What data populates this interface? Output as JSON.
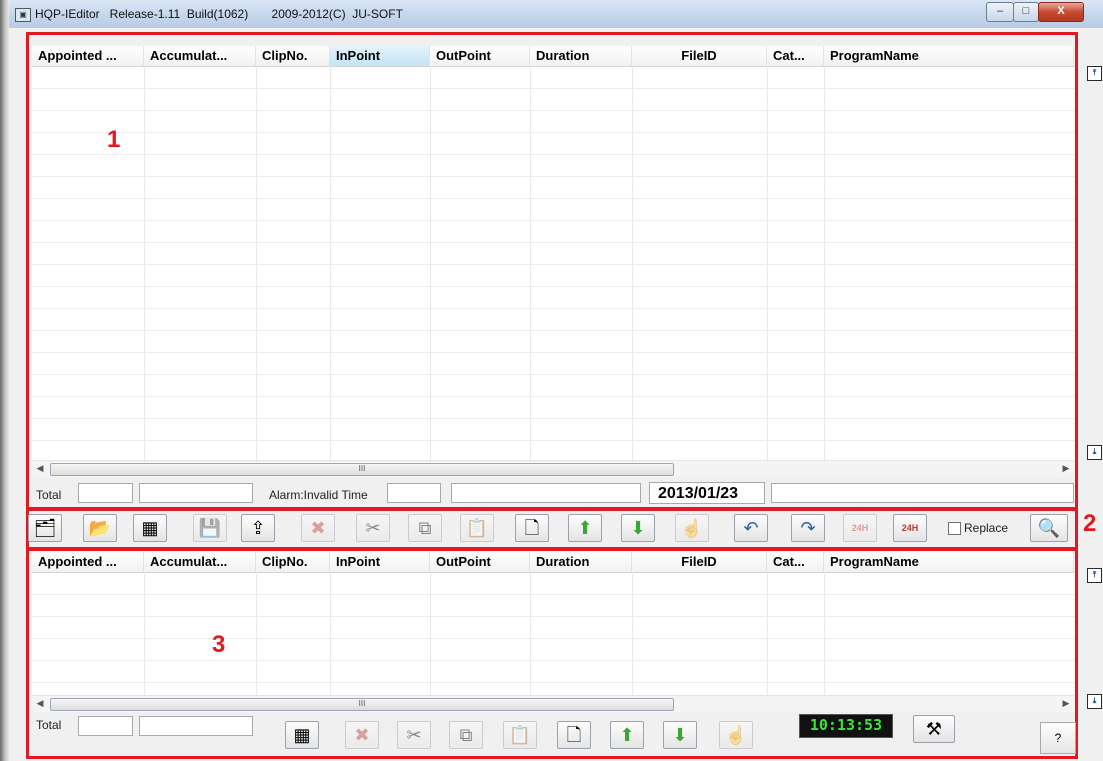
{
  "window": {
    "title": "HQP-IEditor   Release-1.11  Build(1062)       2009-2012(C)  JU-SOFT",
    "min_glyph": "–",
    "max_glyph": "□",
    "close_glyph": "X"
  },
  "panel_labels": {
    "top": "1",
    "toolbar": "2",
    "bottom": "3"
  },
  "columns": [
    "Appointed ...",
    "Accumulat...",
    "ClipNo.",
    "InPoint",
    "OutPoint",
    "Duration",
    "FileID",
    "Cat...",
    "ProgramName"
  ],
  "top_grid": {
    "selected_column": "InPoint",
    "scroll_thumb_glyph": "III"
  },
  "top_status": {
    "total_label": "Total",
    "alarm_label": "Alarm:Invalid Time",
    "date": "2013/01/23"
  },
  "toolbar": {
    "buttons": [
      {
        "name": "open-list",
        "icon": "folder-list-icon",
        "glyph": "🗂"
      },
      {
        "name": "import",
        "icon": "folder-import-icon",
        "glyph": "📂"
      },
      {
        "name": "calculator",
        "icon": "calculator-icon",
        "glyph": "▦"
      },
      {
        "name": "save",
        "icon": "save-icon",
        "glyph": "💾"
      },
      {
        "name": "upload-timeline",
        "icon": "upload-timeline-icon",
        "glyph": "⇪"
      },
      {
        "name": "delete",
        "icon": "delete-icon",
        "glyph": "✖"
      },
      {
        "name": "cut",
        "icon": "scissors-icon",
        "glyph": "✂"
      },
      {
        "name": "copy",
        "icon": "copy-icon",
        "glyph": "⧉"
      },
      {
        "name": "paste",
        "icon": "paste-icon",
        "glyph": "📋"
      },
      {
        "name": "new",
        "icon": "new-document-icon",
        "glyph": "🗋"
      },
      {
        "name": "move-up",
        "icon": "arrow-up-icon",
        "glyph": "⬆"
      },
      {
        "name": "move-down",
        "icon": "arrow-down-icon",
        "glyph": "⬇"
      },
      {
        "name": "clear",
        "icon": "eraser-hand-icon",
        "glyph": "☝"
      },
      {
        "name": "undo",
        "icon": "undo-icon",
        "glyph": "↶"
      },
      {
        "name": "redo",
        "icon": "redo-icon",
        "glyph": "↷"
      },
      {
        "name": "save-24h",
        "icon": "calendar-24h-save-icon",
        "glyph": "24H"
      },
      {
        "name": "load-24h",
        "icon": "calendar-24h-load-icon",
        "glyph": "24H"
      }
    ],
    "replace_label": "Replace",
    "preview_glyph": "🔍"
  },
  "bottom_grid": {
    "scroll_thumb_glyph": "III"
  },
  "bottom_status": {
    "total_label": "Total",
    "clock": "10:13:53",
    "help": "?",
    "buttons": [
      {
        "name": "calculator",
        "icon": "calculator-icon",
        "glyph": "▦"
      },
      {
        "name": "delete",
        "icon": "delete-icon",
        "glyph": "✖"
      },
      {
        "name": "cut",
        "icon": "scissors-icon",
        "glyph": "✂"
      },
      {
        "name": "copy",
        "icon": "copy-icon",
        "glyph": "⧉"
      },
      {
        "name": "paste",
        "icon": "paste-icon",
        "glyph": "📋"
      },
      {
        "name": "new",
        "icon": "new-document-icon",
        "glyph": "🗋"
      },
      {
        "name": "move-up",
        "icon": "arrow-up-icon",
        "glyph": "⬆"
      },
      {
        "name": "move-down",
        "icon": "arrow-down-icon",
        "glyph": "⬇"
      },
      {
        "name": "clear",
        "icon": "eraser-hand-icon",
        "glyph": "☝"
      }
    ],
    "tools_glyph": "⚒"
  },
  "nav_glyphs": {
    "top": "⤒",
    "bottom": "⤓"
  },
  "colors": {
    "annotation_red": "#e01a20",
    "clock_green": "#39e639",
    "selected_header": "#c3e3f7",
    "arrow_green": "#3aa635"
  }
}
